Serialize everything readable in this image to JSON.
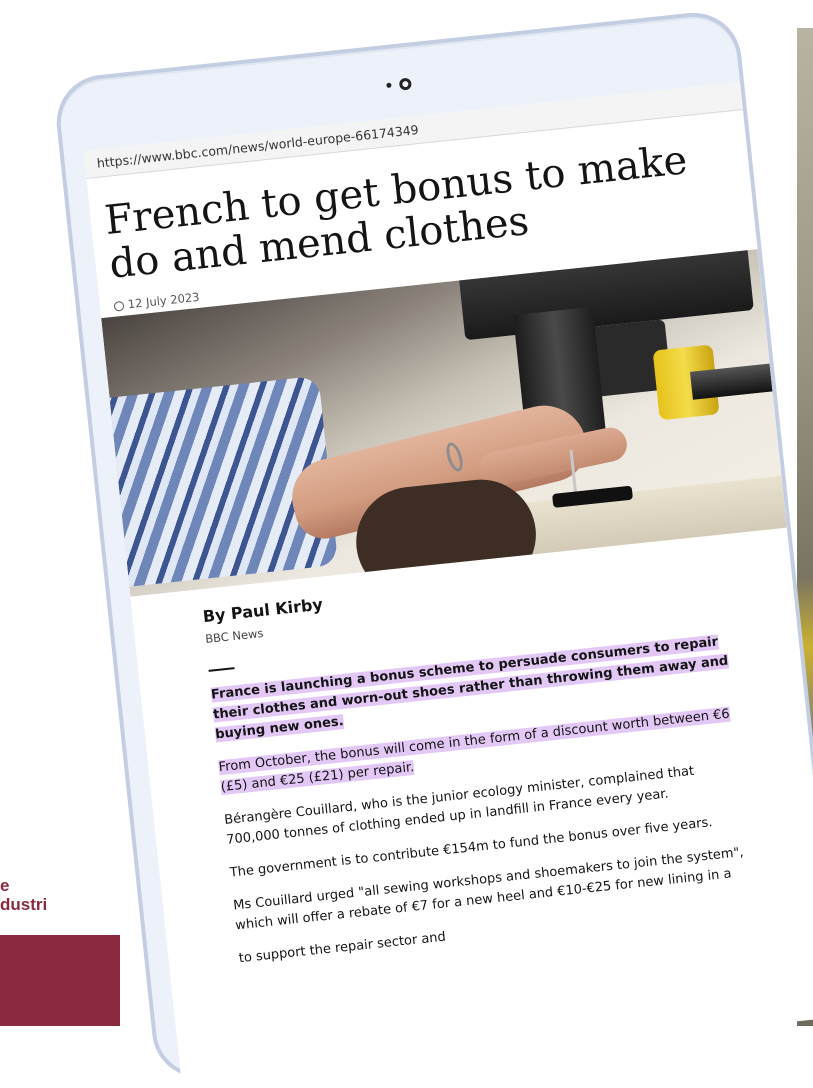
{
  "background": {
    "partial_text_line1": "e",
    "partial_text_line2": "dustri"
  },
  "browser": {
    "url": "https://www.bbc.com/news/world-europe-66174349"
  },
  "article": {
    "headline": "French to get bonus to make do and mend clothes",
    "date": "12 July 2023",
    "author": "By Paul Kirby",
    "source": "BBC News",
    "paragraphs": [
      "France is launching a bonus scheme to persuade consumers to repair their clothes and worn-out shoes rather than throwing them away and buying new ones.",
      "From October, the bonus will come in the form of a discount worth between €6 (£5) and €25 (£21) per repair.",
      "Bérangère Couillard, who is the junior ecology minister, complained that 700,000 tonnes of clothing ended up in landfill in France every year.",
      "The government is to contribute €154m to fund the bonus over five years.",
      "Ms Couillard urged \"all sewing workshops and shoemakers to join the system\", which will offer a rebate of €7 for a new heel and €10-€25 for new lining in a"
    ],
    "partial_last_line": "which will offer a rebate of €7 for a new heel and €10-€25 for new lining in a",
    "trailing_text": "to support the repair sector and"
  },
  "colors": {
    "highlight": "#e3c8f6",
    "brand_maroon": "#8b2a3e",
    "device_frame": "#c4cee2"
  }
}
